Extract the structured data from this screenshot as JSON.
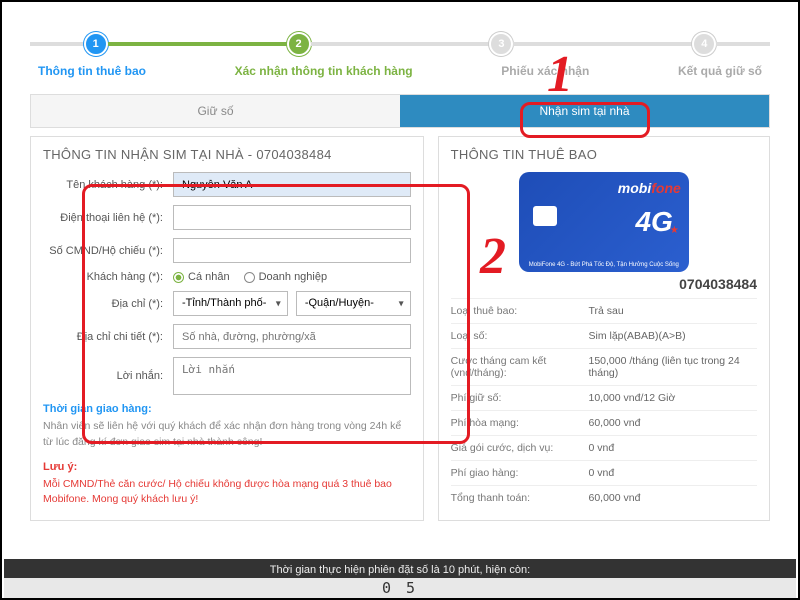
{
  "steps": {
    "s1": "1",
    "s2": "2",
    "s3": "3",
    "s4": "4",
    "labels": {
      "l1": "Thông tin thuê bao",
      "l2": "Xác nhận thông tin khách hàng",
      "l3": "Phiếu xác nhận",
      "l4": "Kết quả giữ số"
    }
  },
  "tabs": {
    "hold": "Giữ số",
    "receive": "Nhận sim tại nhà"
  },
  "form": {
    "title": "THÔNG TIN NHẬN SIM TẠI NHÀ - 0704038484",
    "customer_label": "Tên khách hàng (*):",
    "customer_value": "Nguyễn Văn A",
    "phone_label": "Điện thoại liên hệ (*):",
    "phone_value": "",
    "id_label": "Số CMND/Hộ chiếu (*):",
    "id_value": "",
    "type_label": "Khách hàng (*):",
    "type_personal": "Cá nhân",
    "type_business": "Doanh nghiệp",
    "address_label": "Địa chỉ (*):",
    "sel_city": "-Tỉnh/Thành phố-",
    "sel_district": "-Quận/Huyện-",
    "detail_label": "Địa chỉ chi tiết (*):",
    "detail_placeholder": "Số nhà, đường, phường/xã",
    "message_label": "Lời nhắn:",
    "message_placeholder": "Lời nhắn",
    "delivery_title": "Thời gian giao hàng:",
    "delivery_text": "Nhân viên sẽ liên hệ với quý khách để xác nhận đơn hàng trong vòng 24h kể từ lúc đăng kí đơn giao sim tại nhà thành công!",
    "note_title": "Lưu ý:",
    "note_text": "Mỗi CMND/Thẻ căn cước/ Hộ chiếu không được hòa mạng quá 3 thuê bao Mobifone. Mong quý khách lưu ý!"
  },
  "sub_info": {
    "title": "THÔNG TIN THUÊ BAO",
    "sim_brand_m": "mobi",
    "sim_brand_f": "fone",
    "sim_4g": "4G",
    "sim_tag": "MobiFone 4G - Bứt Phá Tốc Độ, Tận Hưởng Cuộc Sống",
    "phone": "0704038484",
    "rows": [
      {
        "k": "Loại thuê bao:",
        "v": "Trả sau"
      },
      {
        "k": "Loại số:",
        "v": "Sim lặp(ABAB)(A>B)"
      },
      {
        "k": "Cước tháng cam kết (vnđ/tháng):",
        "v": "150,000 /tháng (liên tục trong 24 tháng)"
      },
      {
        "k": "Phí giữ số:",
        "v": "10,000 vnđ/12 Giờ"
      },
      {
        "k": "Phí hòa mạng:",
        "v": "60,000 vnđ"
      },
      {
        "k": "Giá gói cước, dịch vụ:",
        "v": "0 vnđ"
      },
      {
        "k": "Phí giao hàng:",
        "v": "0 vnđ"
      },
      {
        "k": "Tổng thanh toán:",
        "v": "60,000 vnđ"
      }
    ]
  },
  "countdown": {
    "text": "Thời gian thực hiện phiên đặt số là 10 phút, hiện còn:",
    "digits": "0 5"
  },
  "annotations": {
    "n1": "1",
    "n2": "2"
  }
}
